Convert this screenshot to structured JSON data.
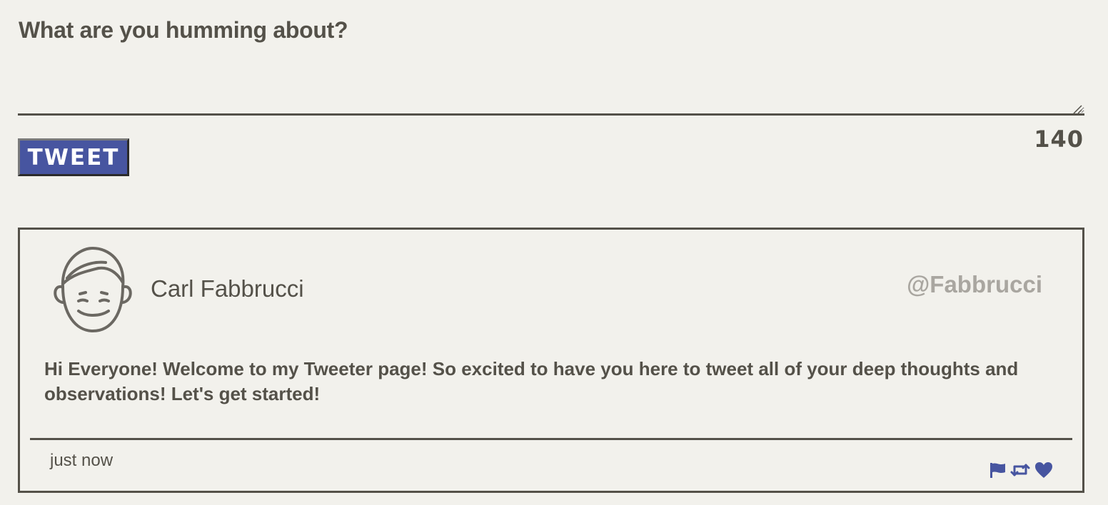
{
  "compose": {
    "label": "What are you humming about?",
    "textarea_value": "",
    "tweet_button_label": "TWEET",
    "char_count": "140"
  },
  "tweet": {
    "display_name": "Carl Fabbrucci",
    "handle": "@Fabbrucci",
    "body": "Hi Everyone! Welcome to my Tweeter page! So excited to have you here to tweet all of your deep thoughts and observations! Let's get started!",
    "timestamp": "just now",
    "icons": [
      "flag-icon",
      "retweet-icon",
      "heart-icon"
    ]
  },
  "colors": {
    "background": "#f2f1ec",
    "text": "#545149",
    "accent": "#4755a0",
    "muted": "#a9a6a0"
  }
}
